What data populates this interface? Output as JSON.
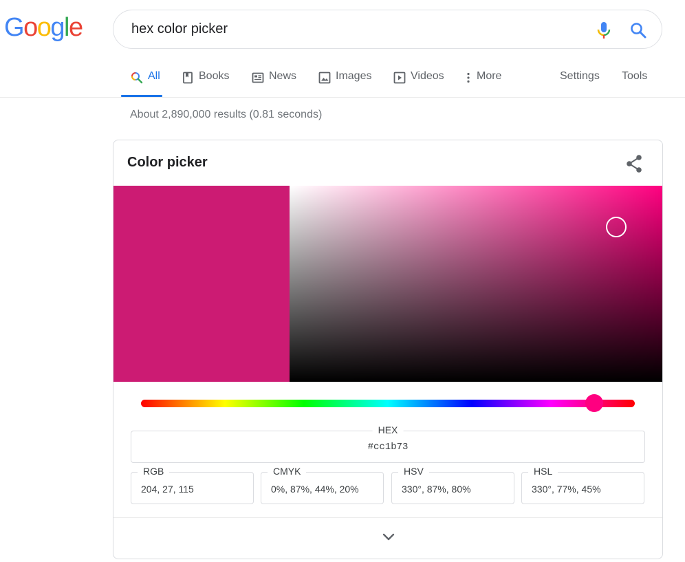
{
  "logo": {
    "letters": [
      {
        "ch": "G",
        "color": "#4285f4"
      },
      {
        "ch": "o",
        "color": "#ea4335"
      },
      {
        "ch": "o",
        "color": "#fbbc05"
      },
      {
        "ch": "g",
        "color": "#4285f4"
      },
      {
        "ch": "l",
        "color": "#34a853"
      },
      {
        "ch": "e",
        "color": "#ea4335"
      }
    ]
  },
  "search": {
    "query": "hex color picker",
    "mic_icon": "mic-icon",
    "search_icon": "search-icon"
  },
  "tabs": {
    "all": {
      "label": "All",
      "icon": "search-icon"
    },
    "books": {
      "label": "Books",
      "icon": "book-icon"
    },
    "news": {
      "label": "News",
      "icon": "news-icon"
    },
    "images": {
      "label": "Images",
      "icon": "image-icon"
    },
    "videos": {
      "label": "Videos",
      "icon": "play-icon"
    },
    "more": {
      "label": "More",
      "icon": "more-vert-icon"
    },
    "settings": {
      "label": "Settings"
    },
    "tools": {
      "label": "Tools"
    }
  },
  "result_stats": "About 2,890,000 results (0.81 seconds)",
  "picker": {
    "title": "Color picker",
    "share_icon": "share-icon",
    "selected_color": "#cc1b73",
    "hue_color": "#ff0080",
    "hue_degrees": 330,
    "saturation": 0.87,
    "value": 0.8,
    "hex": {
      "label": "HEX",
      "value": "#cc1b73"
    },
    "rgb": {
      "label": "RGB",
      "value": "204, 27, 115"
    },
    "cmyk": {
      "label": "CMYK",
      "value": "0%, 87%, 44%, 20%"
    },
    "hsv": {
      "label": "HSV",
      "value": "330°, 87%, 80%"
    },
    "hsl": {
      "label": "HSL",
      "value": "330°, 77%, 45%"
    },
    "expand_icon": "chevron-down-icon"
  },
  "colors": {
    "accent": "#1a73e8",
    "hue_thumb": "#ff0080"
  }
}
